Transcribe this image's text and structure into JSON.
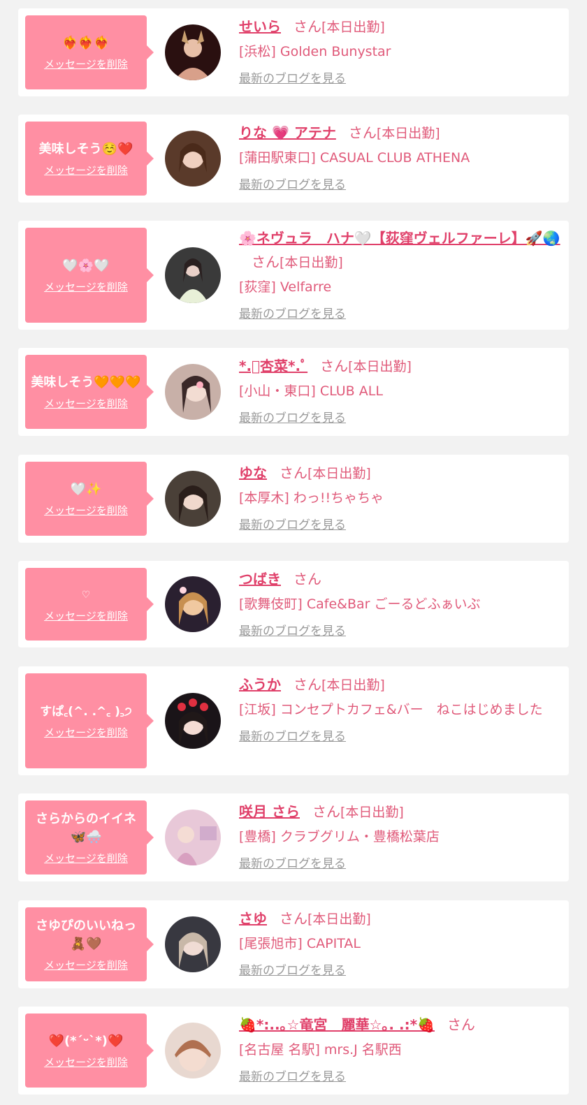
{
  "delete_label": "メッセージを削除",
  "blog_label": "最新のブログを見る",
  "san": "さん",
  "today": "[本日出勤]",
  "colors": {
    "bubble": "#ff8fa3",
    "name": "#e0406a",
    "text": "#e05a7a",
    "link": "#999999"
  },
  "items": [
    {
      "message": "❤️‍🔥❤️‍🔥❤️‍🔥",
      "name": "せいら",
      "today": true,
      "shop": "[浜松] Golden Bunystar"
    },
    {
      "message": "美味しそう☺️❤️",
      "name": "りな 💗 アテナ",
      "today": true,
      "shop": "[蒲田駅東口] CASUAL CLUB ATHENA"
    },
    {
      "message": "🤍🌸🤍",
      "name": "🌸ネヴュラ　ハナ🤍【荻窪ヴェルファーレ】🚀🌏",
      "today": true,
      "shop": "[荻窪] Velfarre"
    },
    {
      "message": "美味しそう🧡🧡🧡",
      "name": "*.ﾟ杏菜*.ﾟ",
      "today": true,
      "shop": "[小山・東口] CLUB ALL"
    },
    {
      "message": "🤍✨",
      "name": "ゆな",
      "today": true,
      "shop": "[本厚木] わっ!!ちゃちゃ"
    },
    {
      "message": "♡",
      "name": "つばき",
      "today": false,
      "shop": "[歌舞伎町] Cafe&Bar ごーるどふぁいぶ"
    },
    {
      "message": "すぱ꜀(^. .^꜀ )꜆੭",
      "name": "ふうか",
      "today": true,
      "shop": "[江坂] コンセプトカフェ&バー　ねこはじめました"
    },
    {
      "message": "さらからのイイネ🦋🌨️",
      "name": "咲月 さら",
      "today": true,
      "shop": "[豊橋] クラブグリム・豊橋松葉店"
    },
    {
      "message": "さゆぴのいいねっ🧸🤎",
      "name": "さゆ",
      "today": true,
      "shop": "[尾張旭市] CAPITAL"
    },
    {
      "message": "❤️(*´ᵕ`*)❤️",
      "name": "🍓*:..｡☆竜宮　麗華☆｡. .:*🍓",
      "today": false,
      "shop": "[名古屋 名駅] mrs.J 名駅西"
    }
  ]
}
